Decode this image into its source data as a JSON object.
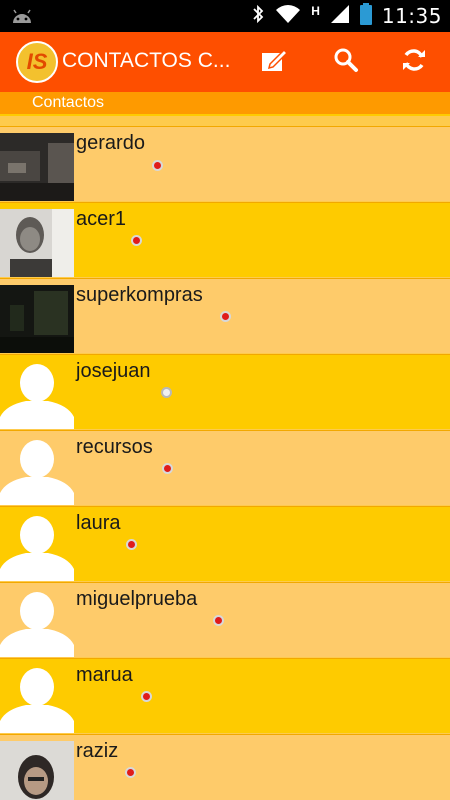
{
  "status_bar": {
    "time": "11:35",
    "icons": [
      "android-icon",
      "bluetooth-icon",
      "wifi-icon",
      "signal-h-icon",
      "signal-icon",
      "battery-icon"
    ],
    "network_label": "H"
  },
  "app_bar": {
    "logo_text": "IS",
    "title": "CONTACTOS C...",
    "actions": [
      "compose-icon",
      "search-icon",
      "refresh-icon"
    ]
  },
  "tab": {
    "label": "Contactos"
  },
  "contacts": [
    {
      "name": "gerardo",
      "status": "offline",
      "avatar": "photo-dark-room"
    },
    {
      "name": "acer1",
      "status": "offline",
      "avatar": "photo-face"
    },
    {
      "name": "superkompras",
      "status": "offline",
      "avatar": "photo-dark"
    },
    {
      "name": "josejuan",
      "status": "unknown",
      "avatar": "default"
    },
    {
      "name": "recursos",
      "status": "offline",
      "avatar": "default"
    },
    {
      "name": "laura",
      "status": "offline",
      "avatar": "default"
    },
    {
      "name": "miguelprueba",
      "status": "offline",
      "avatar": "default"
    },
    {
      "name": "marua",
      "status": "offline",
      "avatar": "default"
    },
    {
      "name": "raziz",
      "status": "offline",
      "avatar": "photo-person"
    }
  ],
  "colors": {
    "app_bar": "#fe4f00",
    "tab_bar": "#fe9a00",
    "row_light": "#fecb6a",
    "row_dark": "#fecb00",
    "status_offline": "#e01b1b",
    "status_unknown": "#f0f0f0"
  }
}
